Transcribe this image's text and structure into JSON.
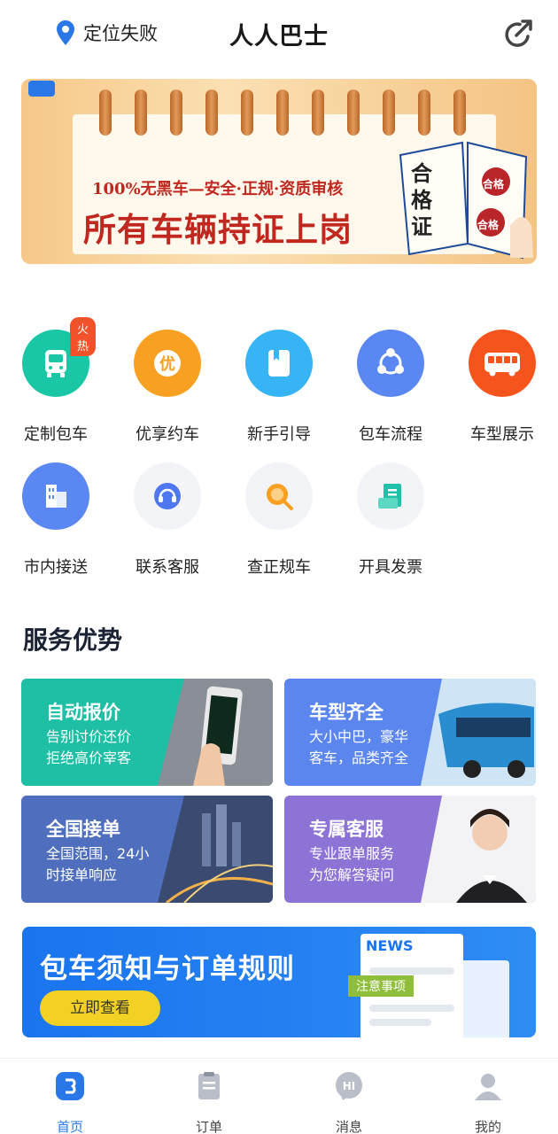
{
  "header": {
    "location_text": "定位失败",
    "title": "人人巴士",
    "icons": [
      "location-pin-icon",
      "share-icon"
    ]
  },
  "banner": {
    "sub_text": "100%无黑车—安全·正规·资质审核",
    "main_text": "所有车辆持证上岗",
    "book_text": "合格证",
    "stamp_text": "合格",
    "colors": {
      "text": "#c0281f",
      "background": "#f6c889"
    }
  },
  "grid": {
    "hot_badge": "火热",
    "items": [
      {
        "label": "定制包车",
        "icon": "bus-icon",
        "color": "#19c6a5"
      },
      {
        "label": "优享约车",
        "icon": "premium-icon",
        "color": "#f7a021"
      },
      {
        "label": "新手引导",
        "icon": "guide-book-icon",
        "color": "#36b4f5"
      },
      {
        "label": "包车流程",
        "icon": "process-icon",
        "color": "#5b87f2"
      },
      {
        "label": "车型展示",
        "icon": "coach-icon",
        "color": "#f5541c"
      },
      {
        "label": "市内接送",
        "icon": "buildings-icon",
        "color": "#5b87f2"
      },
      {
        "label": "联系客服",
        "icon": "headset-icon",
        "color": "#4f78f0"
      },
      {
        "label": "查正规车",
        "icon": "search-icon",
        "color": "#f7a021"
      },
      {
        "label": "开具发票",
        "icon": "invoice-icon",
        "color": "#1fc2a8"
      }
    ]
  },
  "services": {
    "title": "服务优势",
    "cards": [
      {
        "title": "自动报价",
        "desc1": "告别讨价还价",
        "desc2": "拒绝高价宰客",
        "color": "#1ebfa4"
      },
      {
        "title": "车型齐全",
        "desc1": "大小中巴，豪华",
        "desc2": "客车，品类齐全",
        "color": "#5a86ee"
      },
      {
        "title": "全国接单",
        "desc1": "全国范围，24小",
        "desc2": "时接单响应",
        "color": "#4f6fbe"
      },
      {
        "title": "专属客服",
        "desc1": "专业跟单服务",
        "desc2": "为您解答疑问",
        "color": "#8d73d6"
      }
    ]
  },
  "notice": {
    "title": "包车须知与订单规则",
    "button": "立即查看",
    "news_label": "NEWS",
    "tag": "注意事项"
  },
  "tabbar": {
    "active": "首页",
    "tabs": [
      {
        "label": "首页",
        "icon": "home-icon"
      },
      {
        "label": "订单",
        "icon": "order-icon"
      },
      {
        "label": "消息",
        "icon": "message-icon"
      },
      {
        "label": "我的",
        "icon": "profile-icon"
      }
    ]
  }
}
